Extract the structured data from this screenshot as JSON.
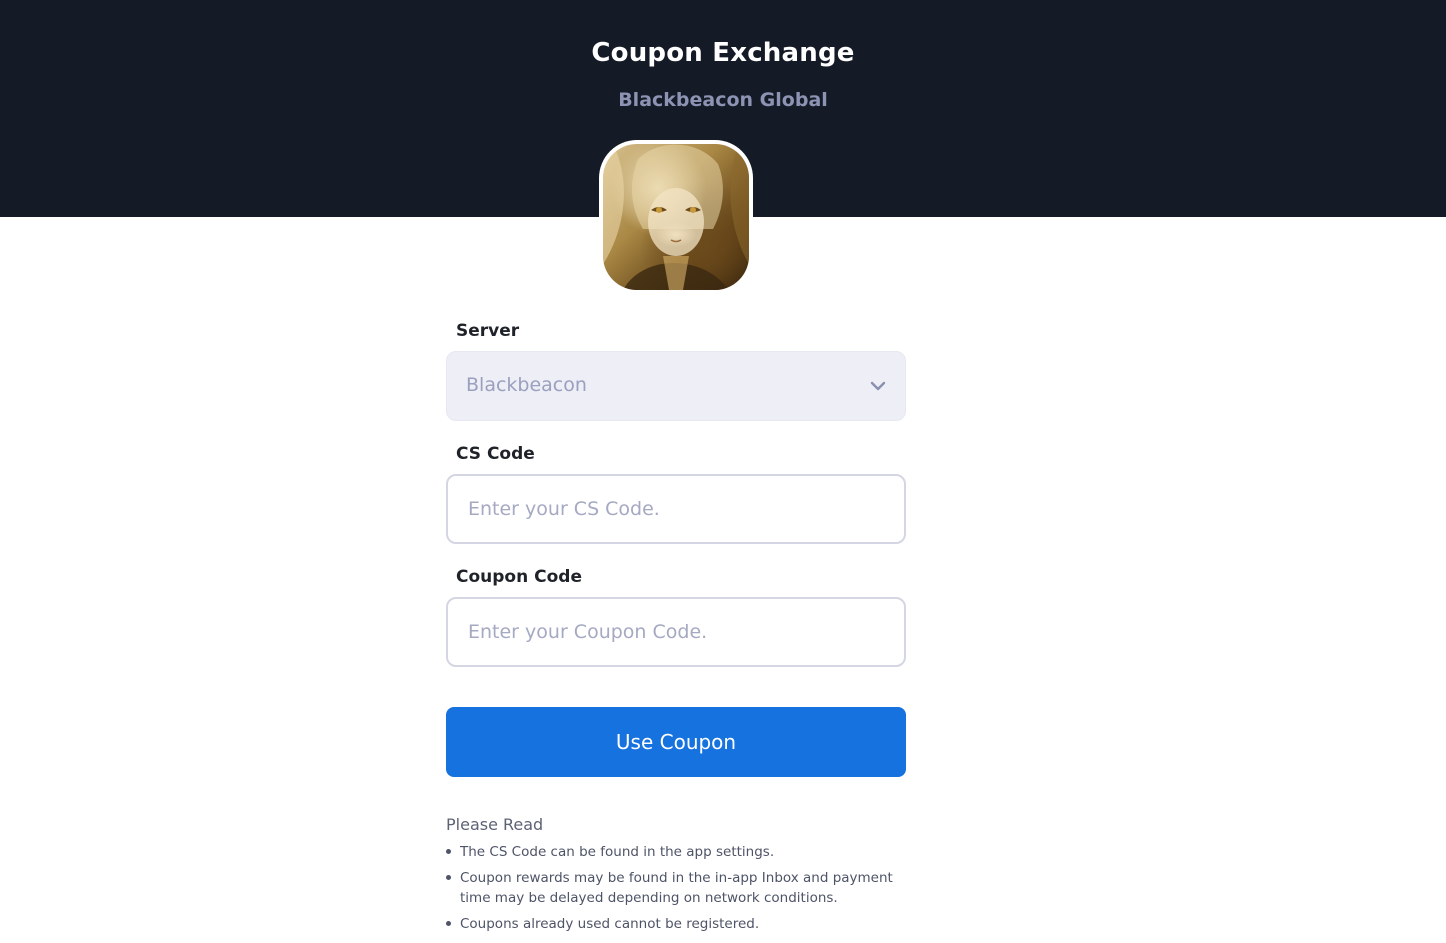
{
  "header": {
    "title": "Coupon Exchange",
    "subtitle": "Blackbeacon Global"
  },
  "game_icon": "blackbeacon-app-icon",
  "form": {
    "server": {
      "label": "Server",
      "selected": "Blackbeacon",
      "icon": "chevron-down-icon"
    },
    "cs_code": {
      "label": "CS Code",
      "value": "",
      "placeholder": "Enter your CS Code."
    },
    "coupon_code": {
      "label": "Coupon Code",
      "value": "",
      "placeholder": "Enter your Coupon Code."
    },
    "submit_label": "Use Coupon"
  },
  "notes": {
    "title": "Please Read",
    "items": [
      "The CS Code can be found in the app settings.",
      "Coupon rewards may be found in the in-app Inbox and payment time may be delayed depending on network conditions.",
      "Coupons already used cannot be registered."
    ]
  },
  "colors": {
    "header_bg": "#151b26",
    "subtitle": "#8c93b3",
    "accent": "#1672de",
    "select_bg": "#edeef6",
    "input_border": "#d4d6e4"
  }
}
